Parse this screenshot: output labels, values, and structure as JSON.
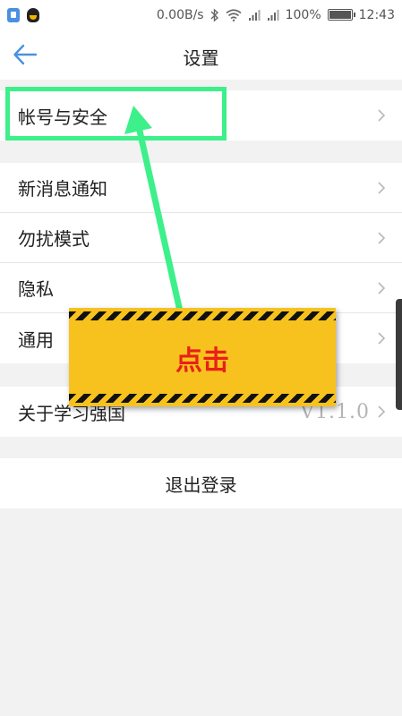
{
  "status_bar": {
    "speed": "0.00B/s",
    "battery": "100%",
    "battery_level": 1.0,
    "time": "12:43",
    "icons": [
      "app-shield-icon",
      "qq-icon",
      "bluetooth-icon",
      "wifi-icon",
      "signal-icon",
      "signal-icon",
      "battery-icon"
    ]
  },
  "header": {
    "title": "设置",
    "back_icon": "arrow-left-icon"
  },
  "settings": {
    "group1": [
      {
        "label": "帐号与安全"
      }
    ],
    "group2": [
      {
        "label": "新消息通知"
      },
      {
        "label": "勿扰模式"
      },
      {
        "label": "隐私"
      },
      {
        "label": "通用"
      }
    ],
    "group3": [
      {
        "label": "关于学习强国",
        "value": "V1.1.0"
      }
    ],
    "logout": "退出登录"
  },
  "annotation": {
    "callout_text": "点击",
    "highlight_color": "#3df08a",
    "callout_color": "#f7c21d",
    "callout_text_color": "#e8201a"
  },
  "colors": {
    "accent": "#4a90e2",
    "background": "#f2f2f2"
  }
}
